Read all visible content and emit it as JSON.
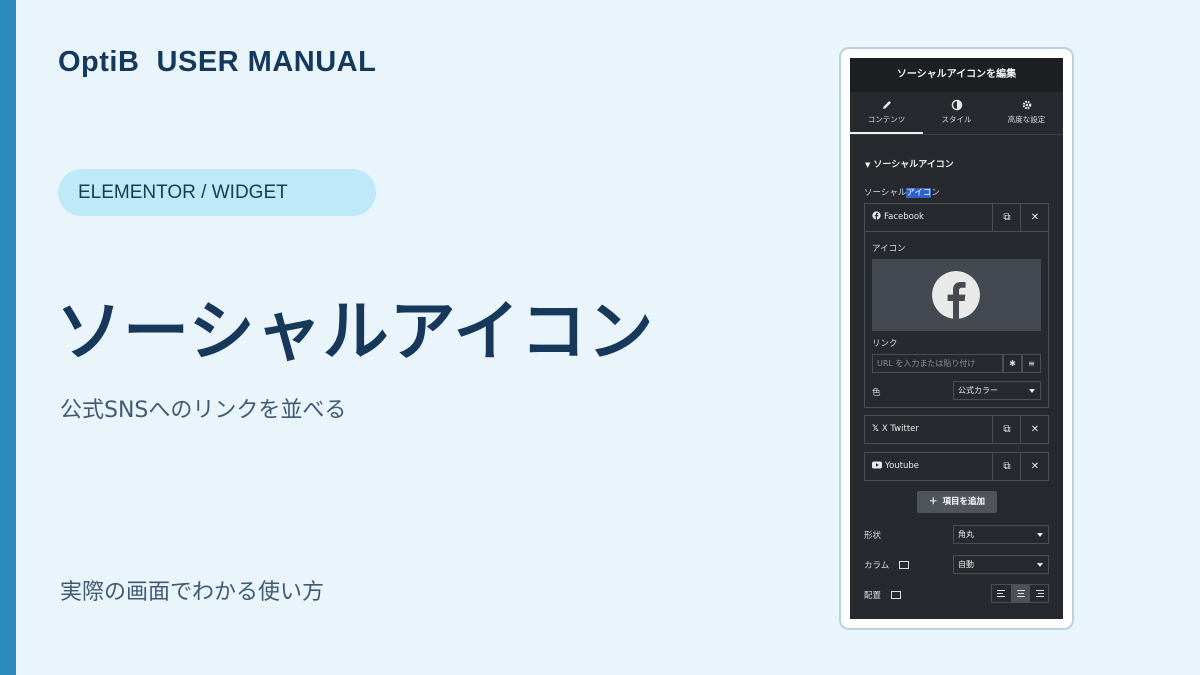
{
  "brand": "OptiB  USER MANUAL",
  "category_pill": "ELEMENTOR / WIDGET",
  "title": "ソーシャルアイコン",
  "subtitle": "公式SNSへのリンクを並べる",
  "caption": "実際の画面でわかる使い方",
  "colors": {
    "accent_bar": "#2b8bbd",
    "background": "#eaf4fb",
    "pill": "#bde9f8",
    "panel": "#26292e"
  },
  "panel": {
    "header": "ソーシャルアイコンを編集",
    "tabs": [
      {
        "label": "コンテンツ",
        "icon": "pencil-icon",
        "active": true
      },
      {
        "label": "スタイル",
        "icon": "contrast-icon",
        "active": false
      },
      {
        "label": "高度な設定",
        "icon": "gear-icon",
        "active": false
      }
    ],
    "section_title": "ソーシャルアイコン",
    "repeater_label_pre": "ソーシャル",
    "repeater_label_hl": "アイコ",
    "repeater_label_post": "ン",
    "items": [
      {
        "name": "Facebook",
        "icon": "facebook-icon"
      },
      {
        "name": "X Twitter",
        "icon": "x-icon"
      },
      {
        "name": "Youtube",
        "icon": "youtube-icon"
      }
    ],
    "expanded": {
      "icon_label": "アイコン",
      "link_label": "リンク",
      "link_placeholder": "URL を入力または貼り付け",
      "color_label": "色",
      "color_value": "公式カラー"
    },
    "add_button": "項目を追加",
    "shape_label": "形状",
    "shape_value": "角丸",
    "columns_label": "カラム",
    "columns_value": "自動",
    "align_label": "配置",
    "align_selected": "center"
  }
}
